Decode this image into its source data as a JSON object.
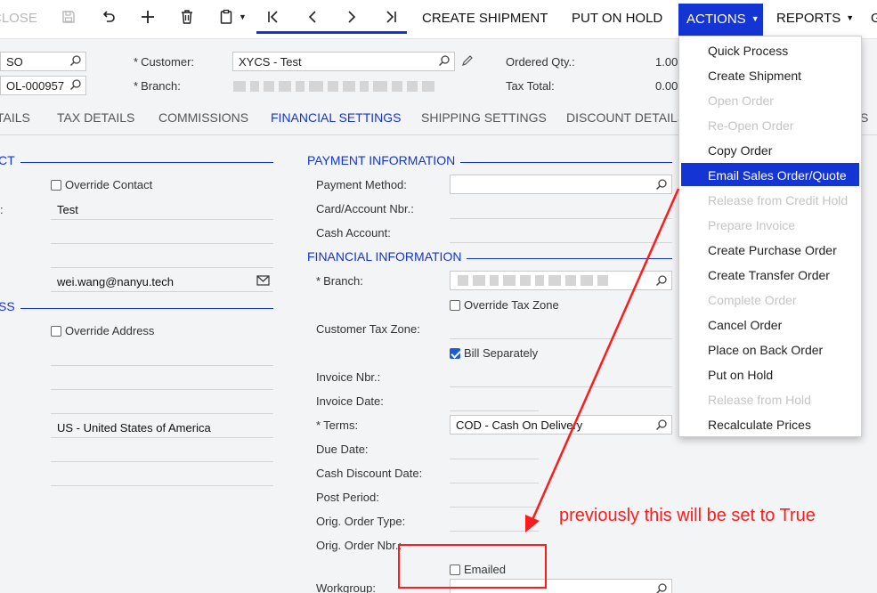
{
  "toolbar": {
    "close_label": "CLOSE",
    "create_shipment": "CREATE SHIPMENT",
    "put_on_hold": "PUT ON HOLD",
    "actions": "ACTIONS",
    "reports": "REPORTS",
    "overflow": "G"
  },
  "header": {
    "order_type": "SO",
    "order_nbr": "OL-000957",
    "customer_label": "Customer:",
    "customer_value": "XYCS - Test",
    "branch_label": "Branch:",
    "ordered_qty_label": "Ordered Qty.:",
    "ordered_qty_value": "1.00",
    "tax_total_label": "Tax Total:",
    "tax_total_value": "0.00"
  },
  "tabs": [
    "TAILS",
    "TAX DETAILS",
    "COMMISSIONS",
    "FINANCIAL SETTINGS",
    "SHIPPING SETTINGS",
    "DISCOUNT DETAILS",
    "S"
  ],
  "left": {
    "contact_title": "CT",
    "override_contact": "Override Contact",
    "contact_label_frag": ":",
    "contact_name": "Test",
    "email": "wei.wang@nanyu.tech",
    "address_title": "SS",
    "override_address": "Override Address",
    "country": "US - United States of America"
  },
  "payment": {
    "title": "PAYMENT INFORMATION",
    "payment_method_label": "Payment Method:",
    "card_label": "Card/Account Nbr.:",
    "cash_account_label": "Cash Account:"
  },
  "financial": {
    "title": "FINANCIAL INFORMATION",
    "branch_label": "Branch:",
    "override_tax_zone": "Override Tax Zone",
    "customer_tax_zone_label": "Customer Tax Zone:",
    "bill_separately": "Bill Separately",
    "invoice_nbr_label": "Invoice Nbr.:",
    "invoice_date_label": "Invoice Date:",
    "terms_label": "Terms:",
    "terms_value": "COD - Cash On Delivery",
    "due_date_label": "Due Date:",
    "cash_discount_date_label": "Cash Discount Date:",
    "post_period_label": "Post Period:",
    "orig_order_type_label": "Orig. Order Type:",
    "orig_order_nbr_label": "Orig. Order Nbr.:",
    "emailed_label": "Emailed",
    "workgroup_label": "Workgroup:"
  },
  "dropdown": {
    "items": [
      {
        "label": "Quick Process",
        "state": "enabled"
      },
      {
        "label": "Create Shipment",
        "state": "enabled"
      },
      {
        "label": "Open Order",
        "state": "disabled"
      },
      {
        "label": "Re-Open Order",
        "state": "disabled"
      },
      {
        "label": "Copy Order",
        "state": "enabled"
      },
      {
        "label": "Email Sales Order/Quote",
        "state": "selected"
      },
      {
        "label": "Release from Credit Hold",
        "state": "disabled"
      },
      {
        "label": "Prepare Invoice",
        "state": "disabled"
      },
      {
        "label": "Create Purchase Order",
        "state": "enabled"
      },
      {
        "label": "Create Transfer Order",
        "state": "enabled"
      },
      {
        "label": "Complete Order",
        "state": "disabled"
      },
      {
        "label": "Cancel Order",
        "state": "enabled"
      },
      {
        "label": "Place on Back Order",
        "state": "enabled"
      },
      {
        "label": "Put on Hold",
        "state": "enabled"
      },
      {
        "label": "Release from Hold",
        "state": "disabled"
      },
      {
        "label": "Recalculate Prices",
        "state": "enabled"
      }
    ]
  },
  "annotation": {
    "text": "previously this will be set to True",
    "color": "#ff1b1b"
  },
  "colors": {
    "accent": "#1534d4"
  }
}
